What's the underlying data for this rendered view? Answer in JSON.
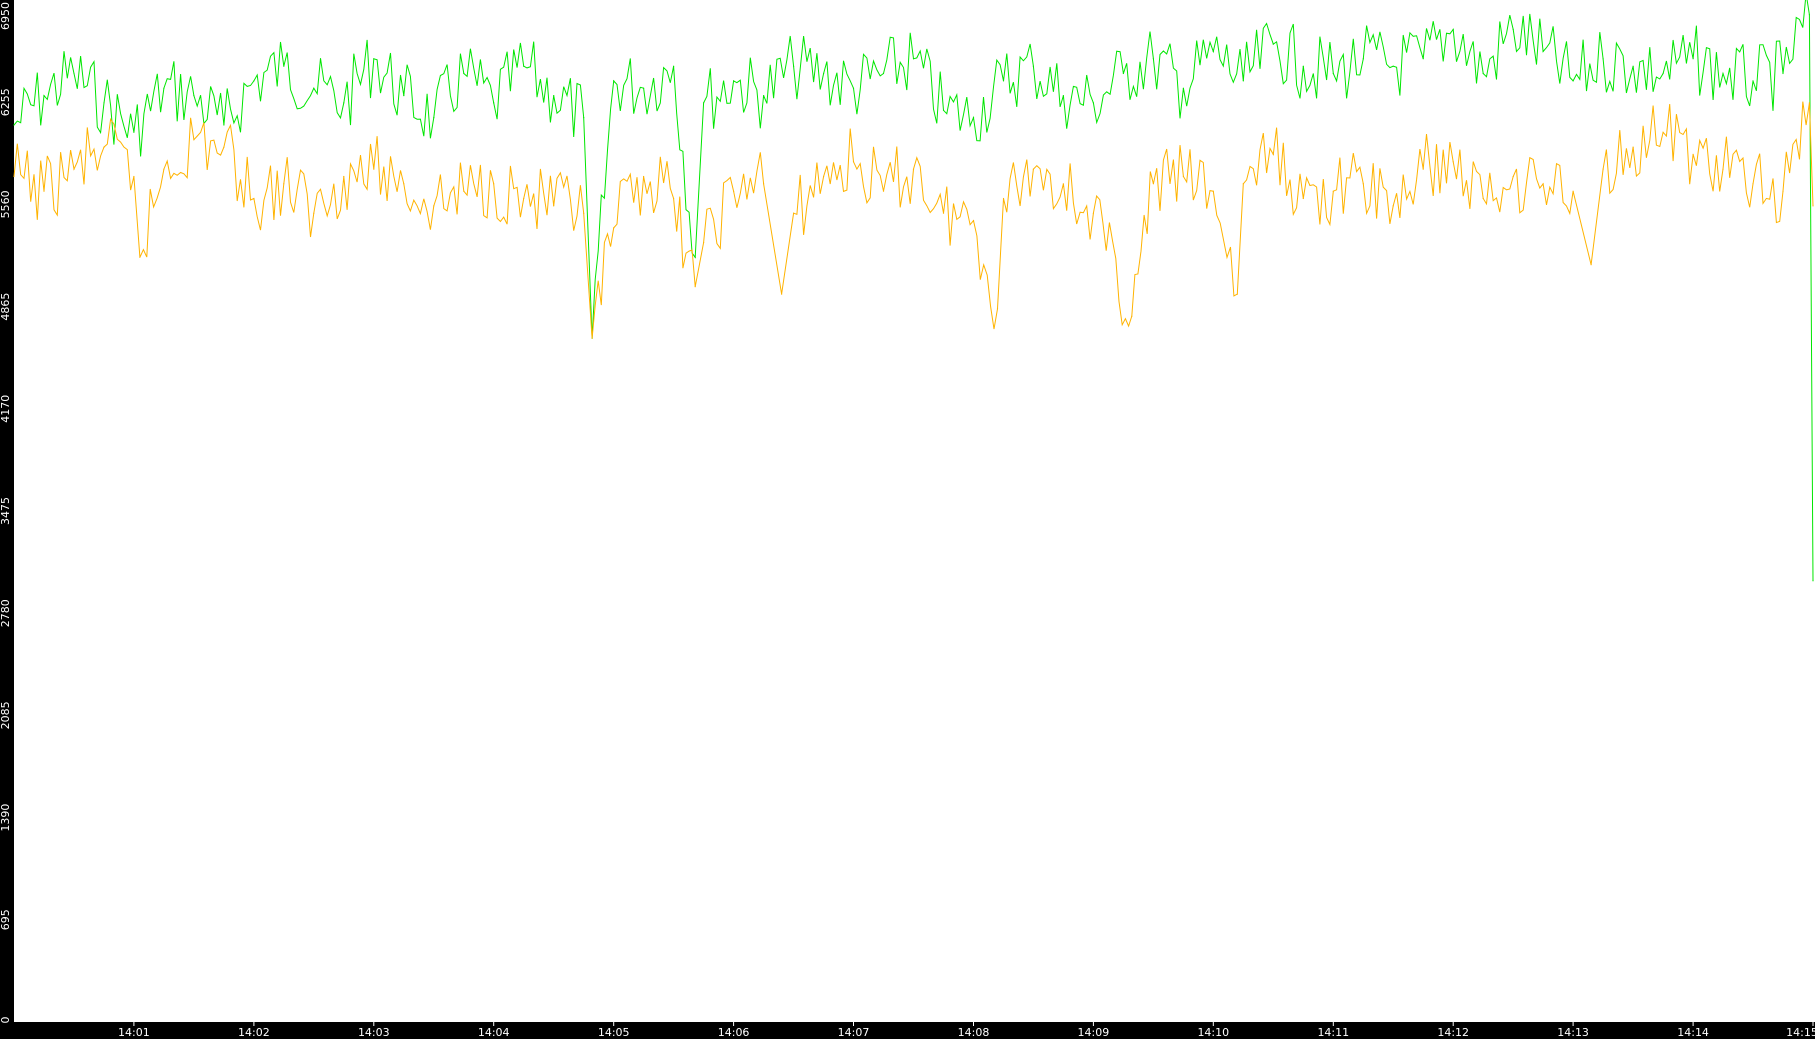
{
  "chart_data": {
    "type": "line",
    "y_ticks": [
      "0",
      "695",
      "1390",
      "2085",
      "2780",
      "3475",
      "4170",
      "4865",
      "5560",
      "6255",
      "6950"
    ],
    "ylim": [
      0,
      6950
    ],
    "x_ticks": [
      "14:01",
      "14:02",
      "14:03",
      "14:04",
      "14:05",
      "14:06",
      "14:07",
      "14:08",
      "14:09",
      "14:10",
      "14:11",
      "14:12",
      "14:13",
      "14:14",
      "14:15"
    ],
    "x_tick_minutes": [
      1,
      2,
      3,
      4,
      5,
      6,
      7,
      8,
      9,
      10,
      11,
      12,
      13,
      14,
      15
    ],
    "xlim_minutes": [
      0.0,
      15.0
    ],
    "grid": false,
    "series": [
      {
        "color": "#00e600",
        "x_minutes": [
          0.0,
          0.25,
          0.5,
          0.75,
          1.0,
          1.25,
          1.5,
          1.75,
          2.0,
          2.25,
          2.5,
          2.75,
          3.0,
          3.25,
          3.5,
          3.75,
          4.0,
          4.25,
          4.5,
          4.75,
          4.82,
          5.0,
          5.25,
          5.5,
          5.68,
          5.75,
          6.0,
          6.25,
          6.5,
          6.75,
          7.0,
          7.25,
          7.5,
          7.75,
          8.0,
          8.25,
          8.5,
          8.75,
          9.0,
          9.25,
          9.5,
          9.75,
          10.0,
          10.25,
          10.5,
          10.75,
          11.0,
          11.25,
          11.5,
          11.75,
          12.0,
          12.25,
          12.5,
          12.75,
          13.0,
          13.25,
          13.5,
          13.75,
          14.0,
          14.25,
          14.5,
          14.75,
          14.97,
          15.0
        ],
        "values": [
          6100,
          6300,
          6450,
          6250,
          6050,
          6350,
          6300,
          6100,
          6400,
          6500,
          6350,
          6250,
          6550,
          6300,
          6150,
          6450,
          6250,
          6500,
          6300,
          6150,
          4650,
          6400,
          6350,
          6500,
          5200,
          6250,
          6400,
          6300,
          6500,
          6450,
          6350,
          6450,
          6550,
          6200,
          6150,
          6400,
          6500,
          6300,
          6250,
          6450,
          6550,
          6350,
          6600,
          6400,
          6650,
          6500,
          6450,
          6550,
          6500,
          6550,
          6750,
          6450,
          6750,
          6600,
          6400,
          6550,
          6500,
          6450,
          6550,
          6450,
          6400,
          6450,
          6850,
          3000
        ]
      },
      {
        "color": "#ffb300",
        "x_minutes": [
          0.0,
          0.25,
          0.5,
          0.75,
          1.0,
          1.05,
          1.25,
          1.5,
          1.75,
          2.0,
          2.25,
          2.5,
          2.75,
          3.0,
          3.25,
          3.5,
          3.75,
          4.0,
          4.25,
          4.5,
          4.75,
          4.82,
          5.0,
          5.25,
          5.5,
          5.68,
          5.75,
          6.0,
          6.25,
          6.4,
          6.5,
          6.75,
          7.0,
          7.25,
          7.5,
          7.75,
          8.0,
          8.2,
          8.25,
          8.5,
          8.75,
          9.0,
          9.32,
          9.5,
          9.75,
          10.0,
          10.2,
          10.25,
          10.5,
          10.75,
          11.0,
          11.25,
          11.5,
          11.75,
          12.0,
          12.25,
          12.5,
          12.75,
          13.0,
          13.15,
          13.25,
          13.5,
          13.75,
          14.0,
          14.25,
          14.5,
          14.75,
          14.97,
          15.0
        ],
        "values": [
          5750,
          5650,
          5800,
          5950,
          5750,
          5200,
          5800,
          6000,
          5950,
          5600,
          5700,
          5500,
          5750,
          5800,
          5700,
          5550,
          5650,
          5700,
          5600,
          5550,
          5500,
          4650,
          5400,
          5750,
          5600,
          5000,
          5300,
          5650,
          5700,
          4950,
          5500,
          5750,
          5850,
          5650,
          5800,
          5500,
          5450,
          4850,
          5600,
          5800,
          5700,
          5500,
          4800,
          5700,
          5750,
          5650,
          4950,
          5700,
          5900,
          5600,
          5650,
          5700,
          5550,
          5800,
          5850,
          5600,
          5750,
          5700,
          5650,
          5150,
          5800,
          5950,
          6050,
          5900,
          5800,
          5700,
          5650,
          6250,
          5550
        ]
      }
    ]
  }
}
